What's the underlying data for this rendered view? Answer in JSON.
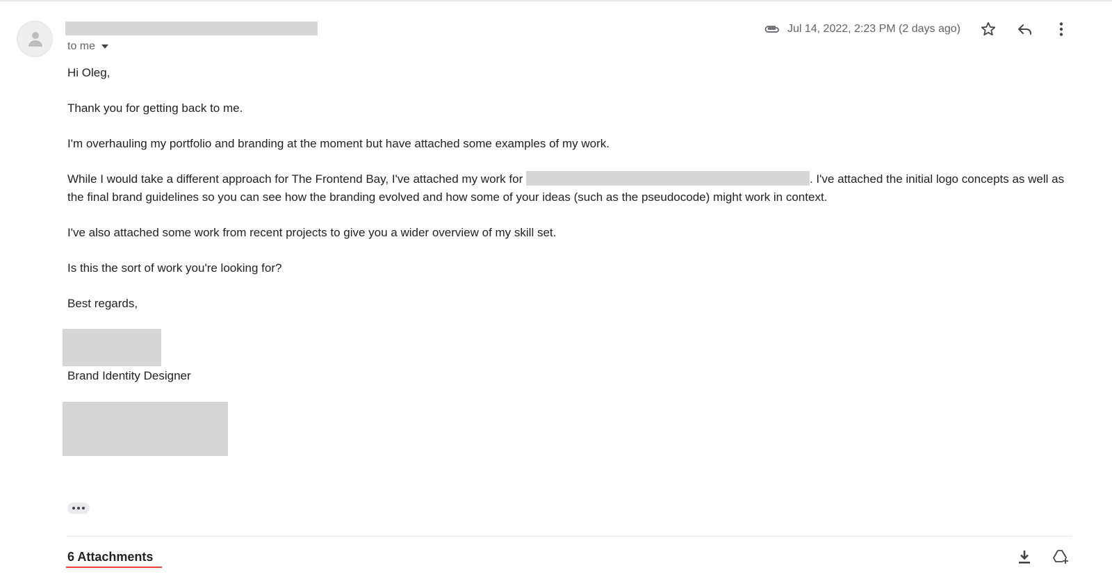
{
  "email": {
    "recipient_label": "to me",
    "date": "Jul 14, 2022, 2:23 PM (2 days ago)",
    "body": {
      "greeting": "Hi Oleg,",
      "p1": "Thank you for getting back to me.",
      "p2": "I'm overhauling my portfolio and branding at the moment but have attached some examples of my work.",
      "p3_before": "While I would take a different approach for The Frontend Bay, I've attached my work for ",
      "p3_after": ". I've attached the initial logo concepts as well as the final brand guidelines so you can see how the branding evolved and how some of your ideas (such as the pseudocode) might work in context.",
      "p4": "I've also attached some work from recent projects to give you a wider overview of my skill set.",
      "p5": "Is this the sort of work you're looking for?",
      "closing": "Best regards,"
    },
    "signature_title": "Brand Identity Designer",
    "attachments_label": "6 Attachments"
  },
  "icons": {
    "attachment": "paperclip-icon",
    "star": "star-icon",
    "reply": "reply-icon",
    "more": "more-vert-icon",
    "download": "download-icon",
    "drive": "add-to-drive-icon"
  },
  "colors": {
    "accent_underline": "#ea4335",
    "redaction": "#d6d6d6"
  }
}
